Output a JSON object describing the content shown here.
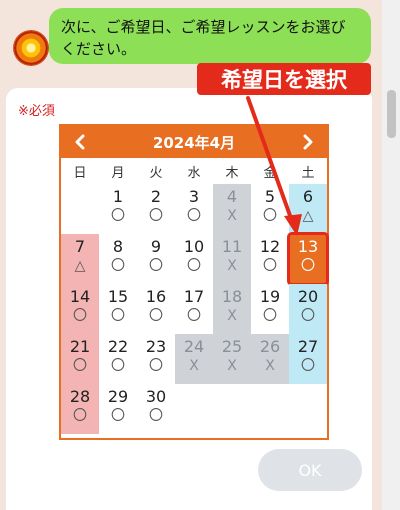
{
  "chat": {
    "avatar": "sun-avatar-icon",
    "message": "次に、ご希望日、ご希望レッスンをお選びください。"
  },
  "form": {
    "required_label": "※必須",
    "ok_label": "OK"
  },
  "calendar": {
    "month_label": "2024年4月",
    "prev_icon": "chevron-left-icon",
    "next_icon": "chevron-right-icon",
    "weekdays": [
      "日",
      "月",
      "火",
      "水",
      "木",
      "金",
      "土"
    ],
    "days": [
      {
        "d": "1",
        "m": "〇",
        "col": 1,
        "row": 0,
        "type": "normal"
      },
      {
        "d": "2",
        "m": "〇",
        "col": 2,
        "row": 0,
        "type": "normal"
      },
      {
        "d": "3",
        "m": "〇",
        "col": 3,
        "row": 0,
        "type": "normal"
      },
      {
        "d": "4",
        "m": "X",
        "col": 4,
        "row": 0,
        "type": "closed"
      },
      {
        "d": "5",
        "m": "〇",
        "col": 5,
        "row": 0,
        "type": "normal"
      },
      {
        "d": "6",
        "m": "△",
        "col": 6,
        "row": 0,
        "type": "sat"
      },
      {
        "d": "7",
        "m": "△",
        "col": 0,
        "row": 1,
        "type": "sun"
      },
      {
        "d": "8",
        "m": "〇",
        "col": 1,
        "row": 1,
        "type": "normal"
      },
      {
        "d": "9",
        "m": "〇",
        "col": 2,
        "row": 1,
        "type": "normal"
      },
      {
        "d": "10",
        "m": "〇",
        "col": 3,
        "row": 1,
        "type": "normal"
      },
      {
        "d": "11",
        "m": "X",
        "col": 4,
        "row": 1,
        "type": "closed"
      },
      {
        "d": "12",
        "m": "〇",
        "col": 5,
        "row": 1,
        "type": "normal"
      },
      {
        "d": "13",
        "m": "〇",
        "col": 6,
        "row": 1,
        "type": "selected"
      },
      {
        "d": "14",
        "m": "〇",
        "col": 0,
        "row": 2,
        "type": "sun"
      },
      {
        "d": "15",
        "m": "〇",
        "col": 1,
        "row": 2,
        "type": "normal"
      },
      {
        "d": "16",
        "m": "〇",
        "col": 2,
        "row": 2,
        "type": "normal"
      },
      {
        "d": "17",
        "m": "〇",
        "col": 3,
        "row": 2,
        "type": "normal"
      },
      {
        "d": "18",
        "m": "X",
        "col": 4,
        "row": 2,
        "type": "closed"
      },
      {
        "d": "19",
        "m": "〇",
        "col": 5,
        "row": 2,
        "type": "normal"
      },
      {
        "d": "20",
        "m": "〇",
        "col": 6,
        "row": 2,
        "type": "sat"
      },
      {
        "d": "21",
        "m": "〇",
        "col": 0,
        "row": 3,
        "type": "sun"
      },
      {
        "d": "22",
        "m": "〇",
        "col": 1,
        "row": 3,
        "type": "normal"
      },
      {
        "d": "23",
        "m": "〇",
        "col": 2,
        "row": 3,
        "type": "normal"
      },
      {
        "d": "24",
        "m": "X",
        "col": 3,
        "row": 3,
        "type": "closed"
      },
      {
        "d": "25",
        "m": "X",
        "col": 4,
        "row": 3,
        "type": "closed"
      },
      {
        "d": "26",
        "m": "X",
        "col": 5,
        "row": 3,
        "type": "closed"
      },
      {
        "d": "27",
        "m": "〇",
        "col": 6,
        "row": 3,
        "type": "sat"
      },
      {
        "d": "28",
        "m": "〇",
        "col": 0,
        "row": 4,
        "type": "sun"
      },
      {
        "d": "29",
        "m": "〇",
        "col": 1,
        "row": 4,
        "type": "normal"
      },
      {
        "d": "30",
        "m": "〇",
        "col": 2,
        "row": 4,
        "type": "normal"
      }
    ]
  },
  "annotation": {
    "callout_text": "希望日を選択",
    "color": "#e42b1b"
  },
  "colors": {
    "accent": "#e86f22",
    "chat_bubble": "#8de055",
    "sunday": "#f4b4b4",
    "saturday": "#bfe9f4",
    "closed": "#cfd2d6"
  }
}
